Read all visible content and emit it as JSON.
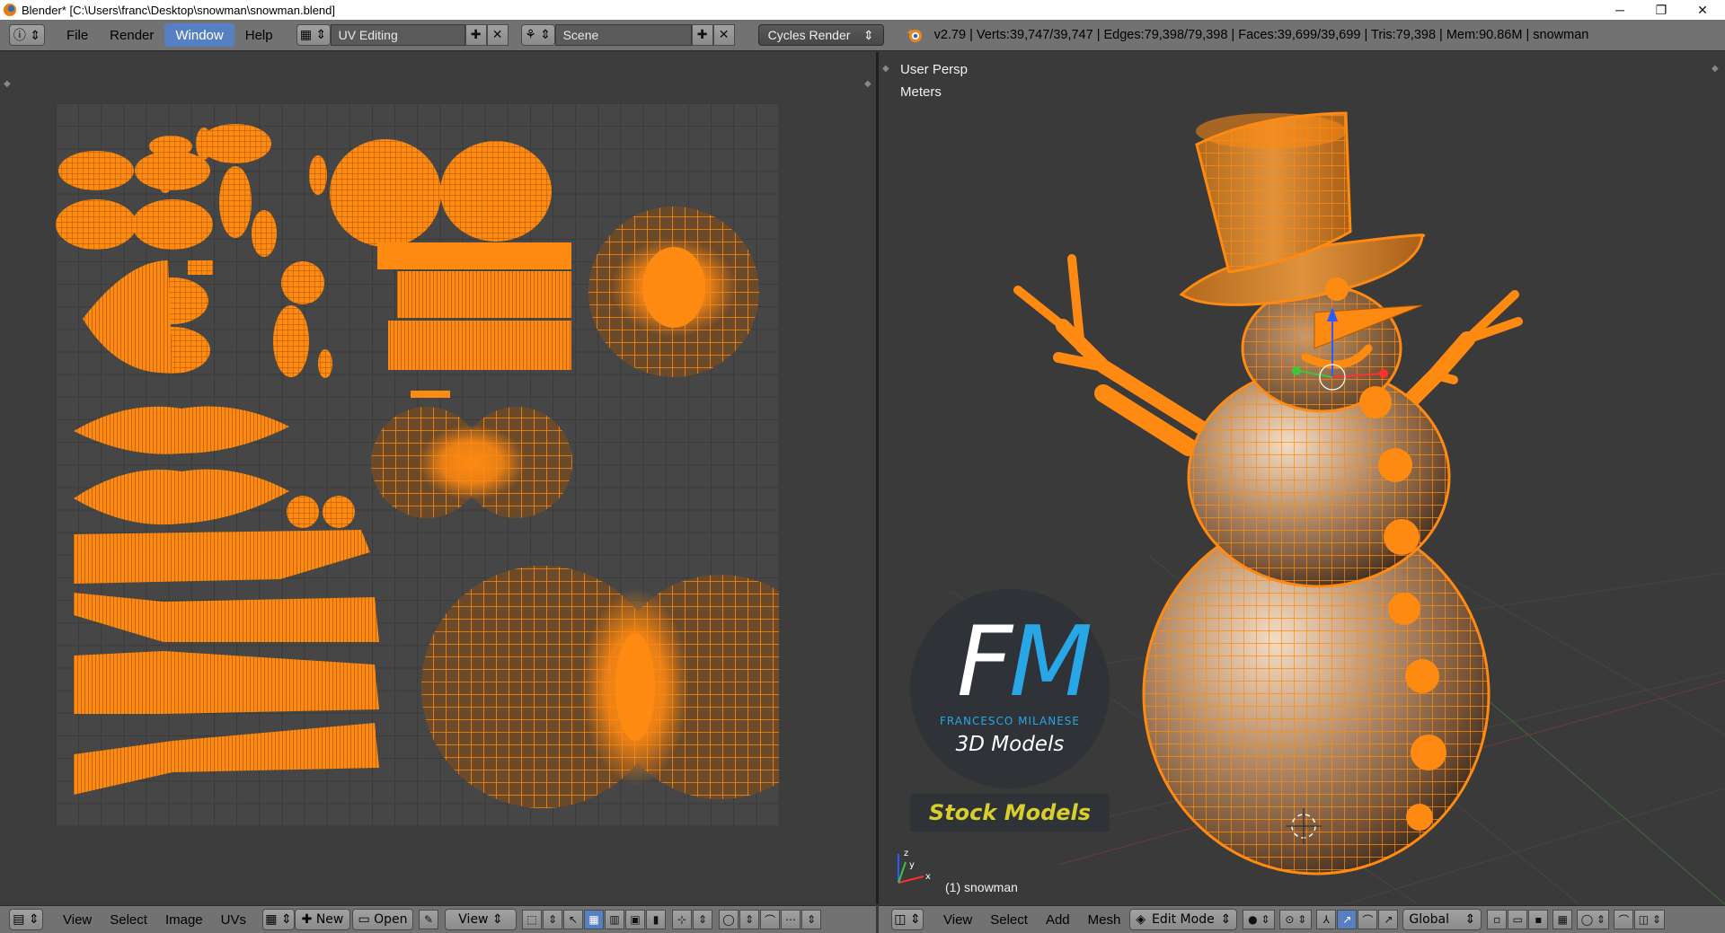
{
  "window": {
    "title": "Blender* [C:\\Users\\franc\\Desktop\\snowman\\snowman.blend]",
    "minimize": "─",
    "restore": "❐",
    "close": "✕"
  },
  "topbar": {
    "menus": [
      "File",
      "Render",
      "Window",
      "Help"
    ],
    "active_menu": "Window",
    "screen_layout": "UV Editing",
    "scene": "Scene",
    "render_engine": "Cycles Render",
    "stats": "v2.79 | Verts:39,747/39,747 | Edges:79,398/79,398 | Faces:39,699/39,699 | Tris:79,398 | Mem:90.86M | snowman"
  },
  "uv_editor": {
    "bottom_menus": [
      "View",
      "Select",
      "Image",
      "UVs"
    ],
    "new_label": "New",
    "open_label": "Open",
    "view_label": "View"
  },
  "viewport": {
    "view_name": "User Persp",
    "units": "Meters",
    "object_label": "(1) snowman",
    "bottom_menus": [
      "View",
      "Select",
      "Add",
      "Mesh"
    ],
    "mode": "Edit Mode",
    "orientation": "Global"
  },
  "watermark": {
    "f": "F",
    "m": "M",
    "name": "FRANCESCO MILANESE",
    "subtitle": "3D Models",
    "stock": "Stock Models"
  },
  "colors": {
    "mesh_orange": "#ff8a12",
    "mesh_dark": "#b35a00",
    "accent_blue": "#5680c2",
    "header_gray": "#727272"
  }
}
